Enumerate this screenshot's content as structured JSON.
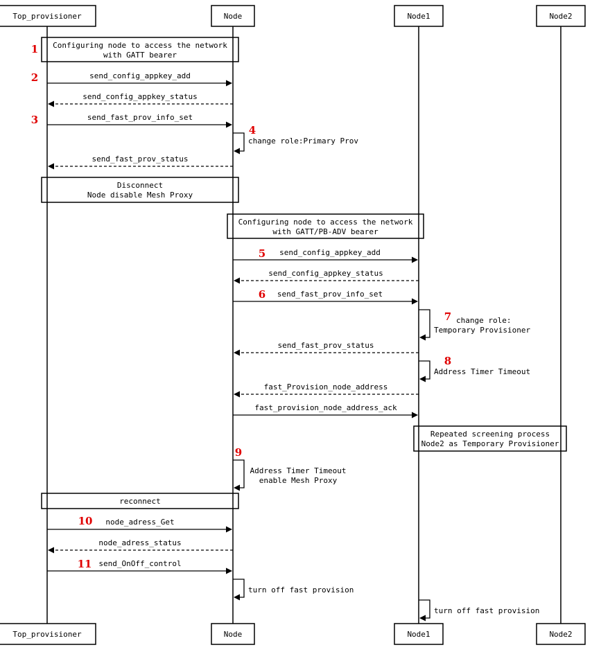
{
  "participants": [
    "Top_provisioner",
    "Node",
    "Node1",
    "Node2"
  ],
  "notes": [
    {
      "lines": [
        "Configuring node  to access the network",
        "with GATT bearer"
      ]
    },
    {
      "lines": [
        "Disconnect",
        "Node disable Mesh Proxy"
      ]
    },
    {
      "lines": [
        "Configuring node  to access the network",
        "with GATT/PB-ADV bearer"
      ]
    },
    {
      "lines": [
        "Repeated screening process",
        "Node2 as Temporary Provisioner"
      ]
    },
    {
      "lines": [
        "reconnect"
      ]
    }
  ],
  "messages": [
    {
      "from": "Top_provisioner",
      "to": "Node",
      "label": "send_config_appkey_add",
      "dashed": false
    },
    {
      "from": "Node",
      "to": "Top_provisioner",
      "label": "send_config_appkey_status",
      "dashed": true
    },
    {
      "from": "Top_provisioner",
      "to": "Node",
      "label": "send_fast_prov_info_set",
      "dashed": false
    },
    {
      "from": "Node",
      "to": "Top_provisioner",
      "label": "send_fast_prov_status",
      "dashed": true
    },
    {
      "from": "Node",
      "to": "Node1",
      "label": "send_config_appkey_add",
      "dashed": false
    },
    {
      "from": "Node1",
      "to": "Node",
      "label": "send_config_appkey_status",
      "dashed": true
    },
    {
      "from": "Node",
      "to": "Node1",
      "label": "send_fast_prov_info_set",
      "dashed": false
    },
    {
      "from": "Node1",
      "to": "Node",
      "label": "send_fast_prov_status",
      "dashed": true
    },
    {
      "from": "Node1",
      "to": "Node",
      "label": "fast_Provision_node_address",
      "dashed": true
    },
    {
      "from": "Node",
      "to": "Node1",
      "label": "fast_provision_node_address_ack",
      "dashed": false
    },
    {
      "from": "Top_provisioner",
      "to": "Node",
      "label": "node_adress_Get",
      "dashed": false
    },
    {
      "from": "Node",
      "to": "Top_provisioner",
      "label": "node_adress_status",
      "dashed": true
    },
    {
      "from": "Top_provisioner",
      "to": "Node",
      "label": "send_OnOff_control",
      "dashed": false
    }
  ],
  "self_messages": [
    {
      "on": "Node",
      "lines": [
        "change role:Primary Prov"
      ]
    },
    {
      "on": "Node1",
      "lines": [
        "change role:",
        "Temporary Provisioner"
      ]
    },
    {
      "on": "Node1",
      "lines": [
        "Address Timer Timeout"
      ]
    },
    {
      "on": "Node",
      "lines": [
        "Address Timer Timeout",
        "enable Mesh Proxy"
      ]
    },
    {
      "on": "Node",
      "lines": [
        "turn off fast provision"
      ]
    },
    {
      "on": "Node1",
      "lines": [
        "turn off fast provision"
      ]
    }
  ],
  "step_numbers": [
    "1",
    "2",
    "3",
    "4",
    "5",
    "6",
    "7",
    "8",
    "9",
    "10",
    "11"
  ],
  "colors": {
    "step_number": "#e00000",
    "line": "#000000"
  }
}
